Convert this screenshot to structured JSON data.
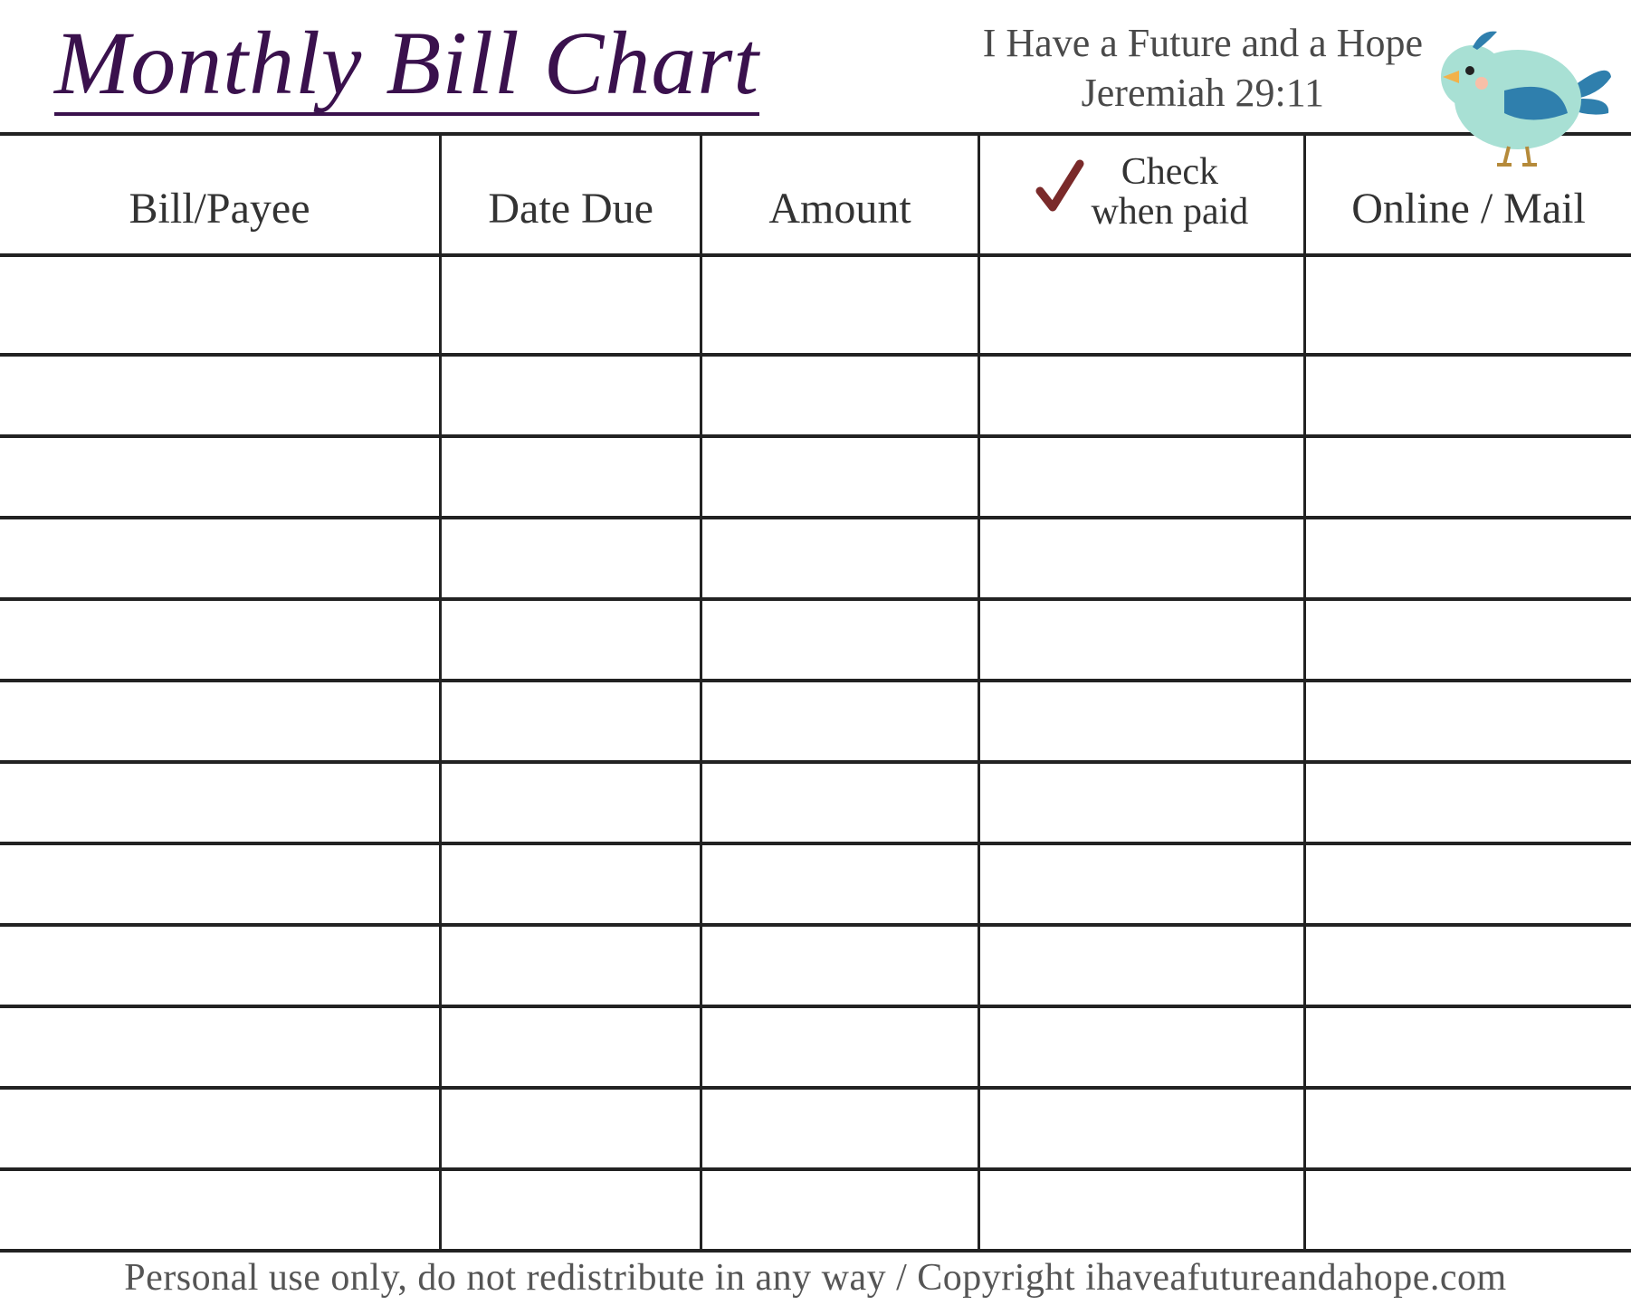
{
  "header": {
    "title": "Monthly Bill Chart",
    "quote_line1": "I Have a Future and a Hope",
    "quote_line2": "Jeremiah 29:11"
  },
  "columns": {
    "payee": "Bill/Payee",
    "date_due": "Date Due",
    "amount": "Amount",
    "check_line1": "Check",
    "check_line2": "when paid",
    "online_mail": "Online / Mail"
  },
  "rows": [
    {
      "payee": "",
      "date_due": "",
      "amount": "",
      "paid": "",
      "online_mail": ""
    },
    {
      "payee": "",
      "date_due": "",
      "amount": "",
      "paid": "",
      "online_mail": ""
    },
    {
      "payee": "",
      "date_due": "",
      "amount": "",
      "paid": "",
      "online_mail": ""
    },
    {
      "payee": "",
      "date_due": "",
      "amount": "",
      "paid": "",
      "online_mail": ""
    },
    {
      "payee": "",
      "date_due": "",
      "amount": "",
      "paid": "",
      "online_mail": ""
    },
    {
      "payee": "",
      "date_due": "",
      "amount": "",
      "paid": "",
      "online_mail": ""
    },
    {
      "payee": "",
      "date_due": "",
      "amount": "",
      "paid": "",
      "online_mail": ""
    },
    {
      "payee": "",
      "date_due": "",
      "amount": "",
      "paid": "",
      "online_mail": ""
    },
    {
      "payee": "",
      "date_due": "",
      "amount": "",
      "paid": "",
      "online_mail": ""
    },
    {
      "payee": "",
      "date_due": "",
      "amount": "",
      "paid": "",
      "online_mail": ""
    },
    {
      "payee": "",
      "date_due": "",
      "amount": "",
      "paid": "",
      "online_mail": ""
    },
    {
      "payee": "",
      "date_due": "",
      "amount": "",
      "paid": "",
      "online_mail": ""
    }
  ],
  "footer": "Personal use only, do not redistribute in any way / Copyright ihaveafutureandahope.com",
  "icons": {
    "checkmark": "checkmark-icon",
    "bird": "bird-icon"
  },
  "colors": {
    "title": "#3a114d",
    "border": "#222222",
    "bird_body": "#a8e0d4",
    "bird_wing": "#2f7fad",
    "bird_beak": "#f2b24a",
    "bird_foot": "#b58a3a",
    "check": "#7a2a2a"
  }
}
